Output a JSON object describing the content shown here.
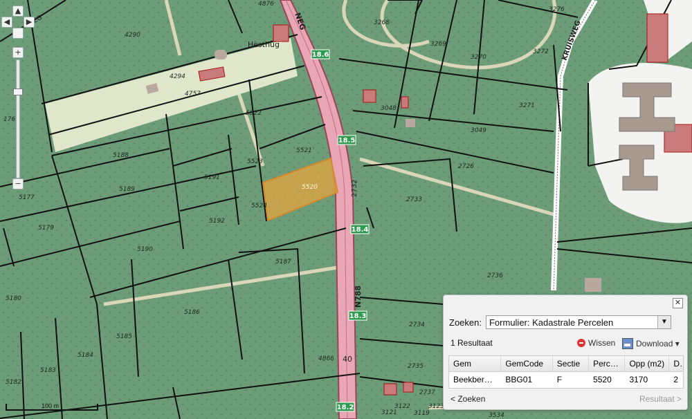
{
  "map": {
    "road_name": "N788",
    "road_top_text": "NEG",
    "road_right_text": "KRUISWEG",
    "road_left_text": "...WEG",
    "place_name": "Hesthug",
    "road_markers": [
      "18.6",
      "18.5",
      "18.4",
      "18.3",
      "18.2"
    ],
    "road_number_vertical": "2732",
    "partial_marker": "40",
    "parcels": [
      "4876",
      "4290",
      "3268",
      "3269",
      "3270",
      "3272",
      "3276",
      "4294",
      "4757",
      "5522",
      "3048",
      "3271",
      "3049",
      "176",
      "5188",
      "5521",
      "5523",
      "2726",
      "5189",
      "5191",
      "5520",
      "5177",
      "5524",
      "2733",
      "5179",
      "5192",
      "5190",
      "5187",
      "2736",
      "5180",
      "5186",
      "2734",
      "5185",
      "5184",
      "4866",
      "2735",
      "5183",
      "5182",
      "2737",
      "3122",
      "3123",
      "3121",
      "3119",
      "3534"
    ],
    "selected_parcel": "5520",
    "colors": {
      "parcel_fill": "#6d9c78",
      "boundary": "#111111",
      "road": "#e9a7b5",
      "selected": "#e5a640",
      "building": "#c97b7b",
      "track": "#d9d7b7"
    }
  },
  "zoom": {
    "pan_up": "▲",
    "pan_left": "◀",
    "pan_right": "▶",
    "zoom_in": "+",
    "zoom_out": "−",
    "level_fraction": 0.25
  },
  "scale": {
    "label": "100 m"
  },
  "panel": {
    "close_label": "✕",
    "search_label": "Zoeken:",
    "search_value": "Formulier: Kadastrale Percelen",
    "dropdown_arrow": "▼",
    "result_count": "1 Resultaat",
    "clear_label": "Wissen",
    "download_label": "Download ▾",
    "columns": [
      "Gem",
      "GemCode",
      "Sectie",
      "Perceel",
      "Opp (m2)",
      "D"
    ],
    "rows": [
      [
        "Beekber…",
        "BBG01",
        "F",
        "5520",
        "3170",
        "2"
      ]
    ],
    "back_label": "< Zoeken",
    "next_label": "Resultaat >"
  }
}
